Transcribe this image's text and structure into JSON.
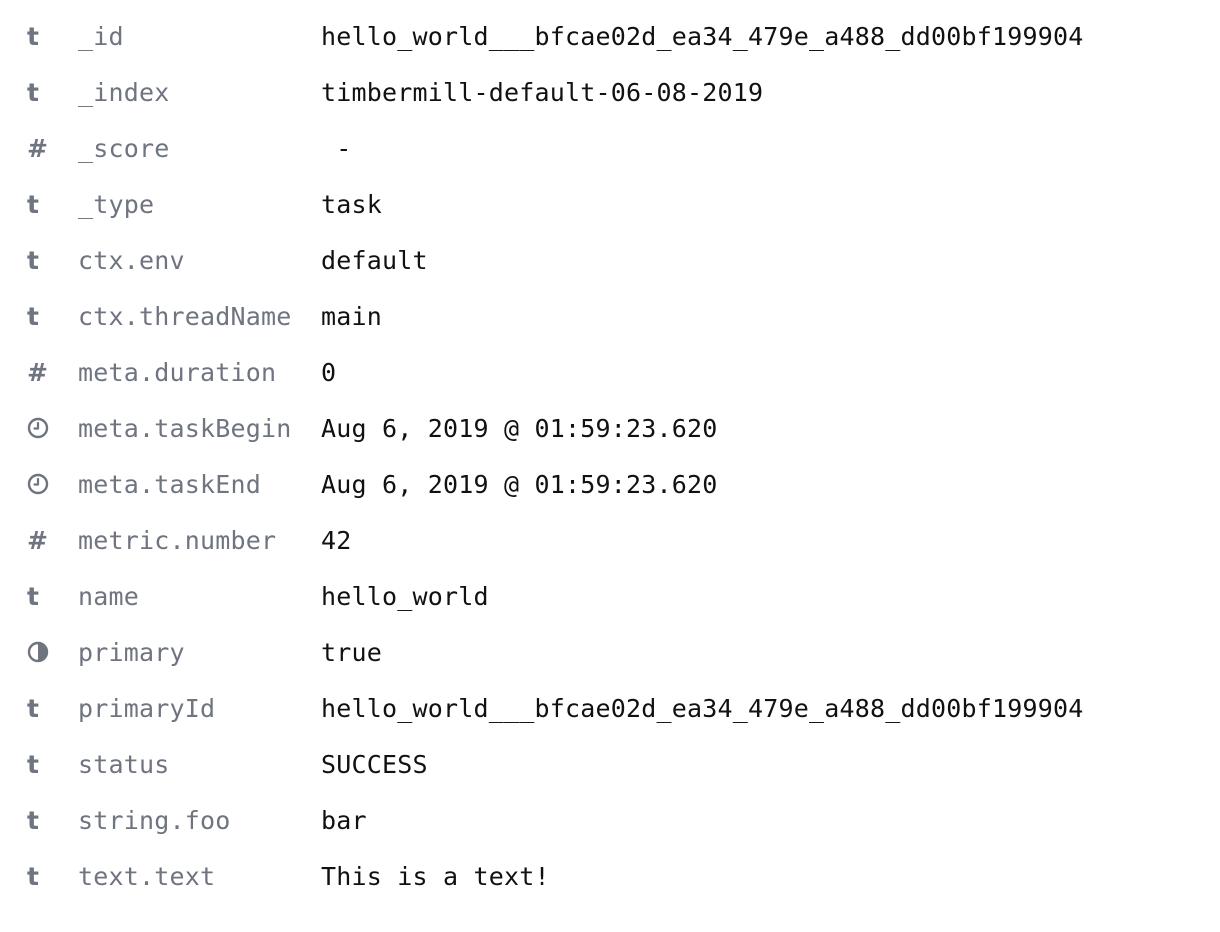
{
  "colors": {
    "field_name": "#6f7481",
    "value": "#111111",
    "icon": "#6f7481"
  },
  "rows": [
    {
      "type": "string",
      "icon_glyph": "t",
      "field": "_id",
      "value": "hello_world___bfcae02d_ea34_479e_a488_dd00bf199904"
    },
    {
      "type": "string",
      "icon_glyph": "t",
      "field": "_index",
      "value": "timbermill-default-06-08-2019"
    },
    {
      "type": "number",
      "icon_glyph": "#",
      "field": "_score",
      "value": " -"
    },
    {
      "type": "string",
      "icon_glyph": "t",
      "field": "_type",
      "value": "task"
    },
    {
      "type": "string",
      "icon_glyph": "t",
      "field": "ctx.env",
      "value": "default"
    },
    {
      "type": "string",
      "icon_glyph": "t",
      "field": "ctx.threadName",
      "value": "main"
    },
    {
      "type": "number",
      "icon_glyph": "#",
      "field": "meta.duration",
      "value": "0"
    },
    {
      "type": "date",
      "icon_glyph": "clock-icon",
      "field": "meta.taskBegin",
      "value": "Aug 6, 2019 @ 01:59:23.620"
    },
    {
      "type": "date",
      "icon_glyph": "clock-icon",
      "field": "meta.taskEnd",
      "value": "Aug 6, 2019 @ 01:59:23.620"
    },
    {
      "type": "number",
      "icon_glyph": "#",
      "field": "metric.number",
      "value": "42"
    },
    {
      "type": "string",
      "icon_glyph": "t",
      "field": "name",
      "value": "hello_world"
    },
    {
      "type": "boolean",
      "icon_glyph": "half-circle-icon",
      "field": "primary",
      "value": "true"
    },
    {
      "type": "string",
      "icon_glyph": "t",
      "field": "primaryId",
      "value": "hello_world___bfcae02d_ea34_479e_a488_dd00bf199904"
    },
    {
      "type": "string",
      "icon_glyph": "t",
      "field": "status",
      "value": "SUCCESS"
    },
    {
      "type": "string",
      "icon_glyph": "t",
      "field": "string.foo",
      "value": "bar"
    },
    {
      "type": "string",
      "icon_glyph": "t",
      "field": "text.text",
      "value": "This is a text!"
    }
  ]
}
